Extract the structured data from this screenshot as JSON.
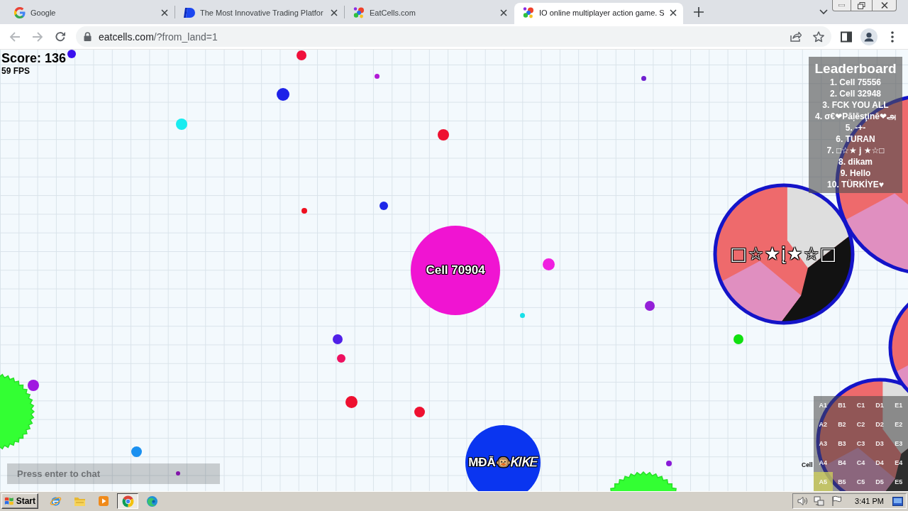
{
  "browser": {
    "tabs": [
      {
        "kind": "search",
        "title": "Google",
        "selected": false
      },
      {
        "kind": "trading",
        "title": "The Most Innovative Trading Platfor",
        "selected": false
      },
      {
        "kind": "game",
        "title": "EatCells.com",
        "selected": false
      },
      {
        "kind": "game",
        "title": "IO online multiplayer action game. S",
        "selected": true
      }
    ],
    "nav_buttons": [
      {
        "kind": "back",
        "disabled": true
      },
      {
        "kind": "forward",
        "disabled": true
      },
      {
        "kind": "reload",
        "disabled": false
      }
    ],
    "address": {
      "host": "eatcells.com",
      "path": "/?from_land=1"
    }
  },
  "game": {
    "score": "Score: 136",
    "fps": "59 FPS",
    "players": [
      {
        "kind": "solid",
        "name": "Cell 70904",
        "color": "#f014d2"
      },
      {
        "kind": "solid",
        "name": "MĐĀ🐵𝐾𝐼𝐾𝐸",
        "color": "#0a35f0"
      },
      {
        "kind": "skin",
        "name": "□☆★į★☆□",
        "color": "#1414c8"
      },
      {
        "kind": "skin",
        "color": "#1414c8"
      },
      {
        "kind": "skin",
        "color": "#1414c8"
      },
      {
        "kind": "skin",
        "color": "#1414c8"
      }
    ],
    "leaderboard": {
      "title": "Leaderboard",
      "entries": [
        "1. Cell 75556",
        "2. Cell 32948",
        "3. FCK YOU ALL",
        "4. σ€❤Pāļēsţinē❤அ",
        "5. -+-",
        "6. TURAN",
        "7. □☆★ j ★☆□",
        "8. dikam",
        "9. Hello",
        "10. TÜRKİYE♥"
      ]
    },
    "minimap": {
      "cells": [
        {
          "label": "A1",
          "selected": false
        },
        {
          "label": "B1",
          "selected": false
        },
        {
          "label": "C1",
          "selected": false
        },
        {
          "label": "D1",
          "selected": false
        },
        {
          "label": "E1",
          "selected": false
        },
        {
          "label": "A2",
          "selected": false
        },
        {
          "label": "B2",
          "selected": false
        },
        {
          "label": "C2",
          "selected": false
        },
        {
          "label": "D2",
          "selected": false
        },
        {
          "label": "E2",
          "selected": false
        },
        {
          "label": "A3",
          "selected": false
        },
        {
          "label": "B3",
          "selected": false
        },
        {
          "label": "C3",
          "selected": false
        },
        {
          "label": "D3",
          "selected": false
        },
        {
          "label": "E3",
          "selected": false
        },
        {
          "label": "A4",
          "selected": false
        },
        {
          "label": "B4",
          "selected": false
        },
        {
          "label": "C4",
          "selected": false
        },
        {
          "label": "D4",
          "selected": false
        },
        {
          "label": "E4",
          "selected": false
        },
        {
          "label": "A5",
          "selected": true
        },
        {
          "label": "B5",
          "selected": false
        },
        {
          "label": "C5",
          "selected": false
        },
        {
          "label": "D5",
          "selected": false
        },
        {
          "label": "E5",
          "selected": false
        }
      ],
      "player_label": "Cell"
    },
    "chat": {
      "placeholder": "Press enter to chat"
    }
  },
  "taskbar": {
    "start": "Start",
    "apps": [
      {
        "kind": "ie",
        "selected": false
      },
      {
        "kind": "explorer",
        "selected": false
      },
      {
        "kind": "media",
        "selected": false
      },
      {
        "kind": "chrome",
        "selected": true
      },
      {
        "kind": "edge",
        "selected": false
      }
    ],
    "clock": "3:41 PM"
  }
}
